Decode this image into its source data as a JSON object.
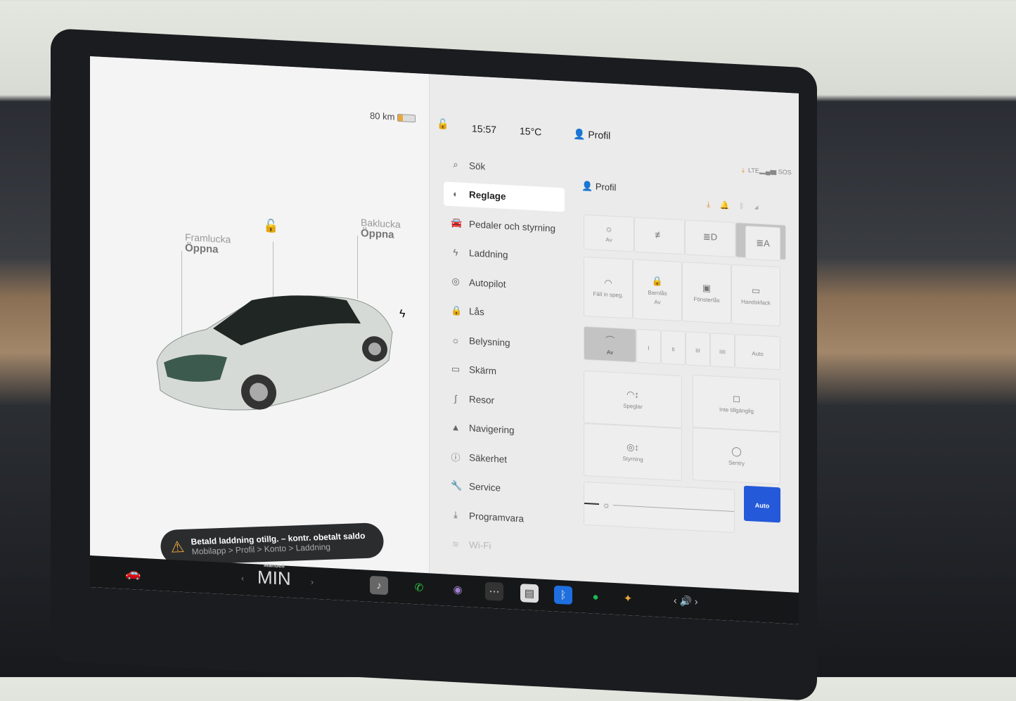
{
  "status": {
    "range": "80 km",
    "time": "15:57",
    "temp": "15°C",
    "profile": "Profil"
  },
  "car": {
    "frunk_title": "Framlucka",
    "frunk_state": "Öppna",
    "trunk_title": "Baklucka",
    "trunk_state": "Öppna"
  },
  "menu": [
    {
      "label": "Sök",
      "icon": "search-icon",
      "g": "⌕"
    },
    {
      "label": "Reglage",
      "icon": "toggle-icon",
      "g": "◐"
    },
    {
      "label": "Pedaler och styrning",
      "icon": "car-icon",
      "g": "🚘"
    },
    {
      "label": "Laddning",
      "icon": "bolt-icon",
      "g": "ϟ"
    },
    {
      "label": "Autopilot",
      "icon": "steering-wheel-icon",
      "g": "◎"
    },
    {
      "label": "Lås",
      "icon": "lock-icon",
      "g": "🔒"
    },
    {
      "label": "Belysning",
      "icon": "sun-icon",
      "g": "☼"
    },
    {
      "label": "Skärm",
      "icon": "screen-icon",
      "g": "▭"
    },
    {
      "label": "Resor",
      "icon": "trips-icon",
      "g": "∫"
    },
    {
      "label": "Navigering",
      "icon": "navigation-icon",
      "g": "▲"
    },
    {
      "label": "Säkerhet",
      "icon": "safety-icon",
      "g": "ⓘ"
    },
    {
      "label": "Service",
      "icon": "wrench-icon",
      "g": "🔧"
    },
    {
      "label": "Programvara",
      "icon": "download-icon",
      "g": "⤓"
    },
    {
      "label": "Wi-Fi",
      "icon": "wifi-icon",
      "g": "≋"
    }
  ],
  "panel": {
    "title": "Profil",
    "lights": [
      {
        "label": "Av",
        "g": "☼",
        "on": false
      },
      {
        "label": "",
        "g": "≢",
        "on": false
      },
      {
        "label": "",
        "g": "≣D",
        "on": false
      },
      {
        "label": "Auto",
        "g": "",
        "on": true
      }
    ],
    "auto_high_beam": "≣A",
    "quick": [
      {
        "label": "Fäll in speg.",
        "g": "◠"
      },
      {
        "label": "Barnlås",
        "sub": "Av",
        "g": "🔒"
      },
      {
        "label": "Fönsterlås",
        "g": "▣"
      },
      {
        "label": "Handskfack",
        "g": "▭"
      }
    ],
    "wipers": [
      {
        "label": "Av",
        "g": "⌒",
        "on": true
      },
      {
        "label": "I"
      },
      {
        "label": "II"
      },
      {
        "label": "III"
      },
      {
        "label": "IIII"
      },
      {
        "label": "Auto"
      }
    ],
    "adjust": [
      {
        "label": "Speglar",
        "g": "◠↕"
      },
      {
        "label": "Styrning",
        "g": "◎↕"
      }
    ],
    "extra": [
      {
        "label": "Inte tillgänglig",
        "g": "◻"
      },
      {
        "label": "Sentry",
        "g": "◯"
      }
    ],
    "brightness_auto": "Auto",
    "brightness_level": 0.1
  },
  "toast": {
    "title": "Betald laddning otillg. – kontr. obetalt saldo",
    "path": "Mobilapp > Profil > Konto > Laddning"
  },
  "dock": {
    "fan_mode": "Manuell",
    "fan_speed": "MIN"
  },
  "colors": {
    "accent": "#2459d9",
    "warning": "#e8a83a",
    "download": "#e88a2a"
  }
}
